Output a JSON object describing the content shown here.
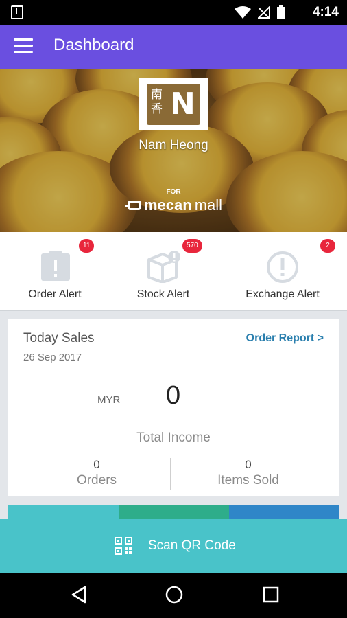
{
  "status_bar": {
    "time": "4:14",
    "icons": [
      "download-icon",
      "wifi-icon",
      "no-signal-icon",
      "battery-icon"
    ]
  },
  "app_bar": {
    "title": "Dashboard",
    "menu_icon": "menu-icon",
    "color": "#6a4fe0"
  },
  "store": {
    "logo_chinese": "南香",
    "logo_letter": "N",
    "name": "Nam Heong",
    "for_label": "FOR",
    "platform_brand_bold": "mecan",
    "platform_brand_light": "mall"
  },
  "alerts": [
    {
      "label": "Order Alert",
      "count": "11",
      "icon": "order-alert-icon"
    },
    {
      "label": "Stock Alert",
      "count": "570",
      "icon": "stock-alert-icon"
    },
    {
      "label": "Exchange Alert",
      "count": "2",
      "icon": "exchange-alert-icon"
    }
  ],
  "sales": {
    "title": "Today Sales",
    "date": "26 Sep 2017",
    "report_link": "Order Report >",
    "currency": "MYR",
    "amount": "0",
    "income_label": "Total Income",
    "orders_value": "0",
    "orders_label": "Orders",
    "items_value": "0",
    "items_label": "Items Sold"
  },
  "strip_colors": [
    "#49c3c9",
    "#2ead8a",
    "#2f86c8"
  ],
  "scan": {
    "label": "Scan QR Code",
    "icon": "qr-code-icon",
    "color": "#49c3c9"
  },
  "nav": {
    "back": "back-icon",
    "home": "home-icon",
    "recents": "recents-icon"
  }
}
